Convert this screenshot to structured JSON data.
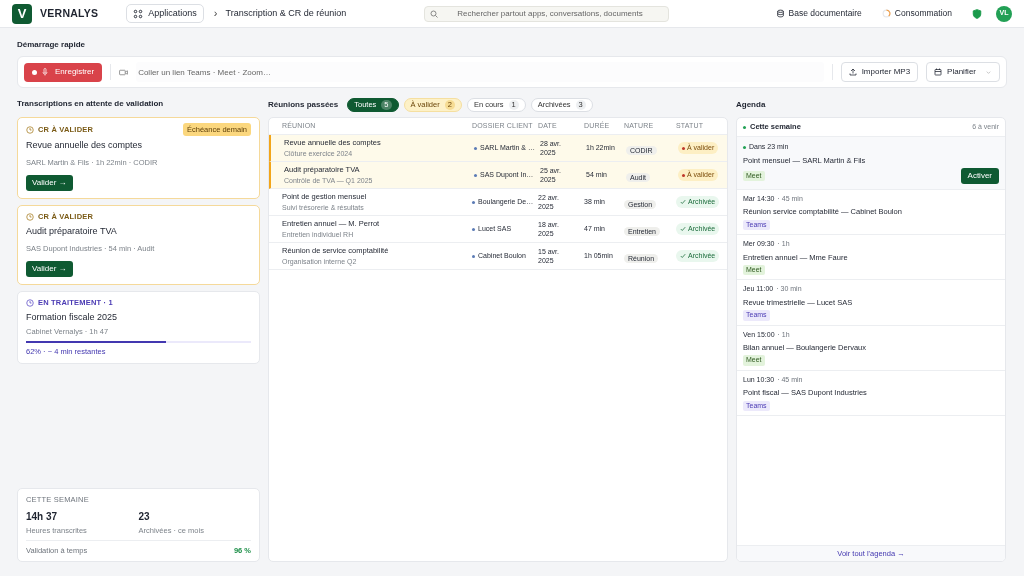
{
  "header": {
    "logo_letter": "V",
    "brand": "VERNALYS",
    "apps_button": "Applications",
    "breadcrumb_separator": "›",
    "breadcrumb": "Transcription & CR de réunion",
    "search": {
      "placeholder": "Rechercher partout apps, conversations, documents"
    },
    "links": [
      "Base documentaire",
      "Consommation"
    ],
    "avatar": "VL"
  },
  "quick_start": {
    "title": "Démarrage rapide",
    "record_button": "Enregistrer",
    "link_field": {
      "placeholder": "Coller un lien Teams · Meet · Zoom…"
    },
    "import_button": "Importer MP3",
    "schedule_button": "Planifier"
  },
  "pending": {
    "title": "Transcriptions en attente de validation",
    "cards": [
      {
        "kind": "pending",
        "status": "CR À VALIDER",
        "badge": "Échéance demain",
        "title": "Revue annuelle des comptes",
        "meta": "SARL Martin & Fils · 1h 22min · CODIR",
        "button": "Valider →"
      },
      {
        "kind": "pending",
        "status": "CR À VALIDER",
        "title": "Audit préparatoire TVA",
        "meta": "SAS Dupont Industries · 54 min · Audit",
        "button": "Valider →"
      },
      {
        "kind": "processing",
        "status": "EN TRAITEMENT · 1",
        "title": "Formation fiscale 2025",
        "meta": "Cabinet Vernalys · 1h 47",
        "level": 0.62,
        "progress_text": "62% · ~ 4 min restantes"
      }
    ]
  },
  "stats": {
    "title": "CETTE SEMAINE",
    "items": [
      {
        "value": "14h 37",
        "label": "Heures transcrites"
      },
      {
        "value": "23",
        "label": "Archivées · ce mois"
      }
    ],
    "footer_label": "Validation à temps",
    "footer_value": "96 %"
  },
  "meetings": {
    "title": "Réunions passées",
    "filters": [
      {
        "label": "Toutes",
        "count": "5",
        "selected": true,
        "kind": "default"
      },
      {
        "label": "À valider",
        "count": "2",
        "selected": false,
        "kind": "warning"
      },
      {
        "label": "En cours",
        "count": "1",
        "selected": false,
        "kind": "default"
      },
      {
        "label": "Archivées",
        "count": "3",
        "selected": false,
        "kind": "default"
      }
    ],
    "columns": [
      "RÉUNION",
      "DOSSIER CLIENT",
      "DATE",
      "DURÉE",
      "NATURE",
      "STATUT"
    ],
    "rows": [
      {
        "title": "Revue annuelle des comptes",
        "subtitle": "Clôture exercice 2024",
        "client": "SARL Martin & …",
        "date": "28 avr. 2025",
        "duration": "1h 22min",
        "nature": "CODIR",
        "status": "À valider",
        "kind": "pending"
      },
      {
        "title": "Audit préparatoire TVA",
        "subtitle": "Contrôle de TVA — Q1 2025",
        "client": "SAS Dupont In…",
        "date": "25 avr. 2025",
        "duration": "54 min",
        "nature": "Audit",
        "status": "À valider",
        "kind": "pending"
      },
      {
        "title": "Point de gestion mensuel",
        "subtitle": "Suivi trésorerie & résultats",
        "client": "Boulangerie De…",
        "date": "22 avr. 2025",
        "duration": "38 min",
        "nature": "Gestion",
        "status": "Archivée",
        "kind": "archived"
      },
      {
        "title": "Entretien annuel — M. Perrot",
        "subtitle": "Entretien individuel RH",
        "client": "Lucet SAS",
        "date": "18 avr. 2025",
        "duration": "47 min",
        "nature": "Entretien",
        "status": "Archivée",
        "kind": "archived"
      },
      {
        "title": "Réunion de service comptabilité",
        "subtitle": "Organisation interne Q2",
        "client": "Cabinet Boulon",
        "date": "15 avr. 2025",
        "duration": "1h 05min",
        "nature": "Réunion",
        "status": "Archivée",
        "kind": "archived"
      }
    ]
  },
  "agenda": {
    "title": "Agenda",
    "week": "Cette semaine",
    "upcoming": "6 à venir",
    "items": [
      {
        "kind": "next",
        "when": "Dans 23 min",
        "title": "Point mensuel — SARL Martin & Fils",
        "tag": "Meet",
        "color": "#e3f3dc",
        "button": "Activer"
      },
      {
        "kind": "normal",
        "when": "Mar 14:30",
        "length": "· 45 min",
        "title": "Réunion service comptabilité — Cabinet Boulon",
        "tag": "Teams",
        "color": "#ece9fb"
      },
      {
        "kind": "normal",
        "when": "Mer 09:30",
        "length": "· 1h",
        "title": "Entretien annuel — Mme Faure",
        "tag": "Meet",
        "color": "#e3f3dc"
      },
      {
        "kind": "normal",
        "when": "Jeu 11:00",
        "length": "· 30 min",
        "title": "Revue trimestrielle — Lucet SAS",
        "tag": "Teams",
        "color": "#ece9fb"
      },
      {
        "kind": "normal",
        "when": "Ven 15:00",
        "length": "· 1h",
        "title": "Bilan annuel — Boulangerie Dervaux",
        "tag": "Meet",
        "color": "#e3f3dc"
      },
      {
        "kind": "normal",
        "when": "Lun 10:30",
        "length": "· 45 min",
        "title": "Point fiscal — SAS Dupont Industries",
        "tag": "Teams",
        "color": "#ece9fb"
      }
    ],
    "footer_link": "Voir tout l'agenda →"
  }
}
